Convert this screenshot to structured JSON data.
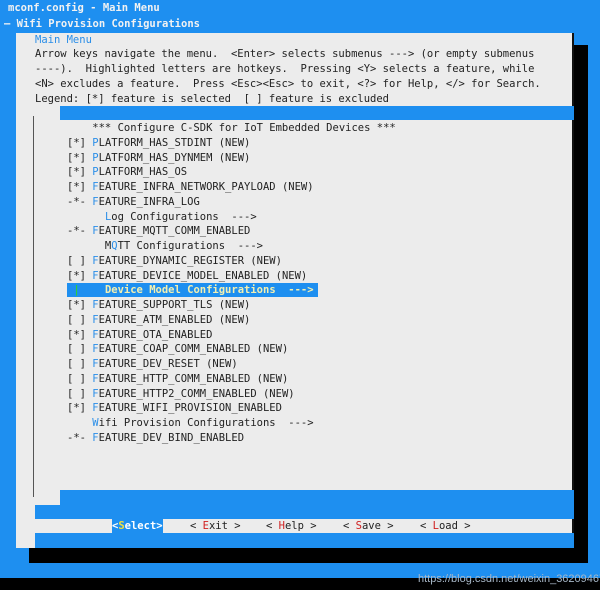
{
  "window": {
    "title": "mconf.config - Main Menu",
    "breadcrumb": "— Wifi Provision Configurations"
  },
  "dialog": {
    "title": "Main Menu",
    "help_lines": [
      "Arrow keys navigate the menu.  <Enter> selects submenus ---> (or empty submenus",
      "----).  Highlighted letters are hotkeys.  Pressing <Y> selects a feature, while",
      "<N> excludes a feature.  Press <Esc><Esc> to exit, <?> for Help, </> for Search.",
      "Legend: [*] feature is selected  [ ] feature is excluded"
    ]
  },
  "menu": {
    "items": [
      {
        "pre": "    *** Configure C-SDK for IoT Embedded Devices ***",
        "hot": "",
        "rest": ""
      },
      {
        "pre": "[*] ",
        "hot": "P",
        "rest": "LATFORM_HAS_STDINT (NEW)"
      },
      {
        "pre": "[*] ",
        "hot": "P",
        "rest": "LATFORM_HAS_DYNMEM (NEW)"
      },
      {
        "pre": "[*] ",
        "hot": "P",
        "rest": "LATFORM_HAS_OS"
      },
      {
        "pre": "[*] ",
        "hot": "F",
        "rest": "EATURE_INFRA_NETWORK_PAYLOAD (NEW)"
      },
      {
        "pre": "-*- ",
        "hot": "F",
        "rest": "EATURE_INFRA_LOG"
      },
      {
        "pre": "      ",
        "hot": "L",
        "rest": "og Configurations  --->"
      },
      {
        "pre": "-*- ",
        "hot": "F",
        "rest": "EATURE_MQTT_COMM_ENABLED"
      },
      {
        "pre": "      M",
        "hot": "Q",
        "rest": "TT Configurations  --->"
      },
      {
        "pre": "[ ] ",
        "hot": "F",
        "rest": "EATURE_DYNAMIC_REGISTER (NEW)"
      },
      {
        "pre": "[*] ",
        "hot": "F",
        "rest": "EATURE_DEVICE_MODEL_ENABLED (NEW)"
      },
      {
        "pre": "      ",
        "hot": "",
        "rest": "Device Model Configurations  --->",
        "selected": true
      },
      {
        "pre": "[*] ",
        "hot": "F",
        "rest": "EATURE_SUPPORT_TLS (NEW)"
      },
      {
        "pre": "[ ] ",
        "hot": "F",
        "rest": "EATURE_ATM_ENABLED (NEW)"
      },
      {
        "pre": "[*] ",
        "hot": "F",
        "rest": "EATURE_OTA_ENABLED"
      },
      {
        "pre": "[ ] ",
        "hot": "F",
        "rest": "EATURE_COAP_COMM_ENABLED (NEW)"
      },
      {
        "pre": "[ ] ",
        "hot": "F",
        "rest": "EATURE_DEV_RESET (NEW)"
      },
      {
        "pre": "[ ] ",
        "hot": "F",
        "rest": "EATURE_HTTP_COMM_ENABLED (NEW)"
      },
      {
        "pre": "[ ] ",
        "hot": "F",
        "rest": "EATURE_HTTP2_COMM_ENABLED (NEW)"
      },
      {
        "pre": "[*] ",
        "hot": "F",
        "rest": "EATURE_WIFI_PROVISION_ENABLED"
      },
      {
        "pre": "    ",
        "hot": "W",
        "rest": "ifi Provision Configurations  --->"
      },
      {
        "pre": "-*- ",
        "hot": "F",
        "rest": "EATURE_DEV_BIND_ENABLED"
      }
    ]
  },
  "buttons": [
    {
      "open": "<",
      "hot": "S",
      "rest": "elect",
      "close": ">",
      "active": true
    },
    {
      "open": "< ",
      "hot": "E",
      "rest": "xit",
      "close": " >"
    },
    {
      "open": "< ",
      "hot": "H",
      "rest": "elp",
      "close": " >"
    },
    {
      "open": "< ",
      "hot": "S",
      "rest": "ave",
      "close": " >"
    },
    {
      "open": "< ",
      "hot": "L",
      "rest": "oad",
      "close": " >"
    }
  ],
  "watermark": "https://blog.csdn.net/weixin_36209467",
  "colors": {
    "background": "#1e8ff0",
    "dialog": "#ececec",
    "hotkey": "#2a8ee8",
    "button_hotkey": "#d02020"
  }
}
